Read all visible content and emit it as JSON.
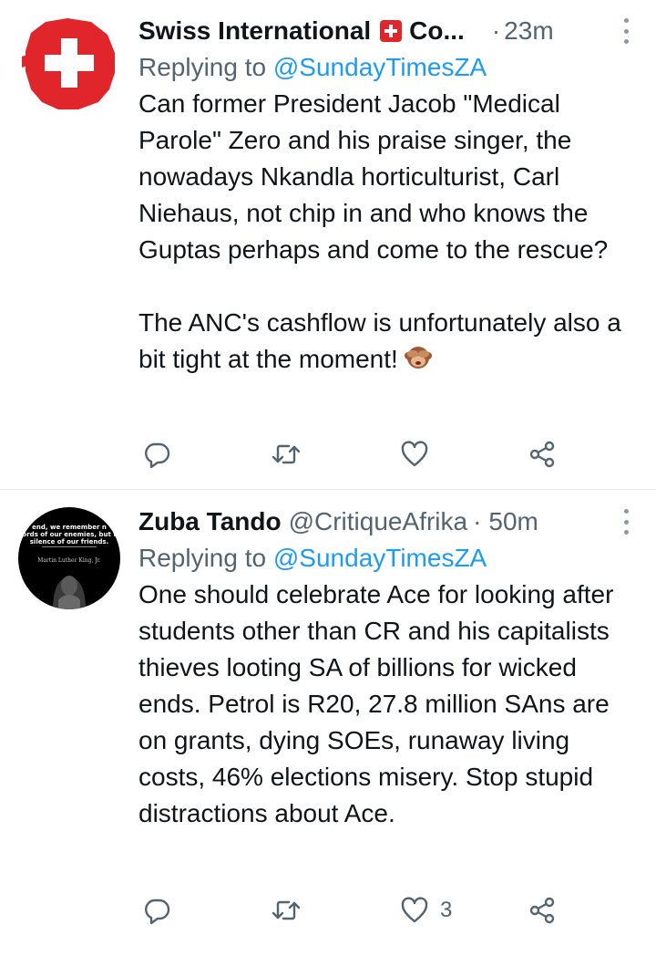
{
  "tweets": [
    {
      "author_name": "Swiss International",
      "author_suffix": "Co...",
      "dot": "·",
      "time": "23m",
      "replying_prefix": "Replying to ",
      "replying_to": "@SundayTimesZA",
      "text": "Can former President Jacob \"Medical Parole\" Zero and his praise singer, the nowadays Nkandla horticulturist, Carl Niehaus, not chip in and who knows the Guptas perhaps and come to the rescue?\n\nThe ANC's cashflow is unfortunately also a bit tight at the moment!",
      "emoji": "see-no-evil-monkey",
      "like_count": ""
    },
    {
      "author_name": "Zuba Tando",
      "author_handle": "@CritiqueAfrika",
      "dot": "·",
      "time": "50m",
      "replying_prefix": "Replying to ",
      "replying_to": "@SundayTimesZA",
      "text": "One should celebrate Ace for looking after students other than CR and his capitalists thieves looting SA of billions for wicked ends. Petrol is R20, 27.8 million SAns are on grants, dying SOEs, runaway living costs, 46% elections misery. Stop stupid distractions about Ace.",
      "like_count": "3",
      "avatar_text": {
        "line1": "end, we remember n",
        "line2": "ords of our enemies, but t",
        "line3": "silence of our friends.",
        "signature": "Martin Luther King, Jr."
      }
    }
  ],
  "icons": {
    "reply": "reply-icon",
    "retweet": "retweet-icon",
    "like": "like-icon",
    "share": "share-icon",
    "more": "more-icon"
  },
  "colors": {
    "text": "#0f1419",
    "secondary": "#536471",
    "link": "#1d9bf0",
    "flag_red": "#e0262b",
    "divider": "#e6e8ea"
  }
}
